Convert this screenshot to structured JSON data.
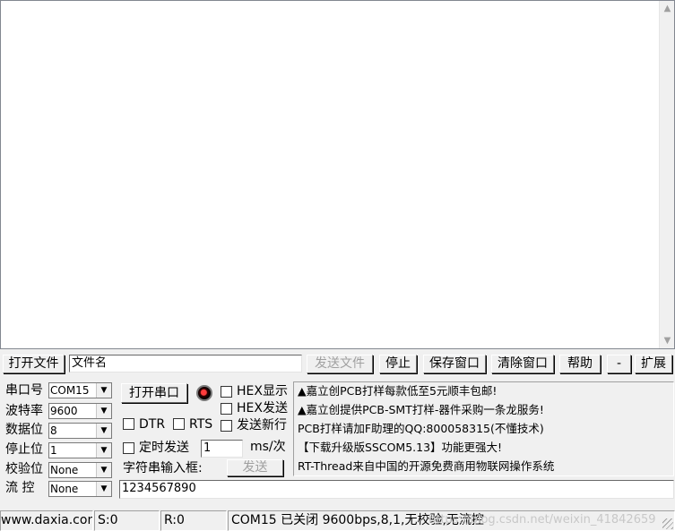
{
  "toolbar": {
    "open_file": "打开文件",
    "filename": "文件名",
    "send_file": "发送文件",
    "stop": "停止",
    "save_window": "保存窗口",
    "clear_window": "清除窗口",
    "help": "帮助",
    "minus": "-",
    "expand": "扩展"
  },
  "settings": {
    "port_label": "串口号",
    "port_value": "COM15",
    "baud_label": "波特率",
    "baud_value": "9600",
    "databits_label": "数据位",
    "databits_value": "8",
    "stopbits_label": "停止位",
    "stopbits_value": "1",
    "parity_label": "校验位",
    "parity_value": "None",
    "flow_label": "流 控",
    "flow_value": "None"
  },
  "controls": {
    "open_port": "打开串口",
    "hex_display": "HEX显示",
    "hex_send": "HEX发送",
    "dtr": "DTR",
    "rts": "RTS",
    "send_newline": "发送新行",
    "timed_send": "定时发送",
    "interval_value": "1",
    "interval_unit": "ms/次",
    "input_label": "字符串输入框:",
    "send": "发送",
    "input_value": "1234567890"
  },
  "ads": [
    "▲嘉立创PCB打样每款低至5元顺丰包邮!",
    "▲嘉立创提供PCB-SMT打样-器件采购一条龙服务!",
    "PCB打样请加F助理的QQ:800058315(不懂技术)",
    "【下载升级版SSCOM5.13】功能更强大!",
    "RT-Thread来自中国的开源免费商用物联网操作系统"
  ],
  "status": {
    "website": "www.daxia.com",
    "sent": "S:0",
    "received": "R:0",
    "port_state": "COM15 已关闭  9600bps,8,1,无校验,无流控",
    "watermark": "https://blog.csdn.net/weixin_41842659"
  },
  "icons": {
    "scroll_up": "▲",
    "scroll_down": "▼",
    "dropdown": "▼"
  }
}
